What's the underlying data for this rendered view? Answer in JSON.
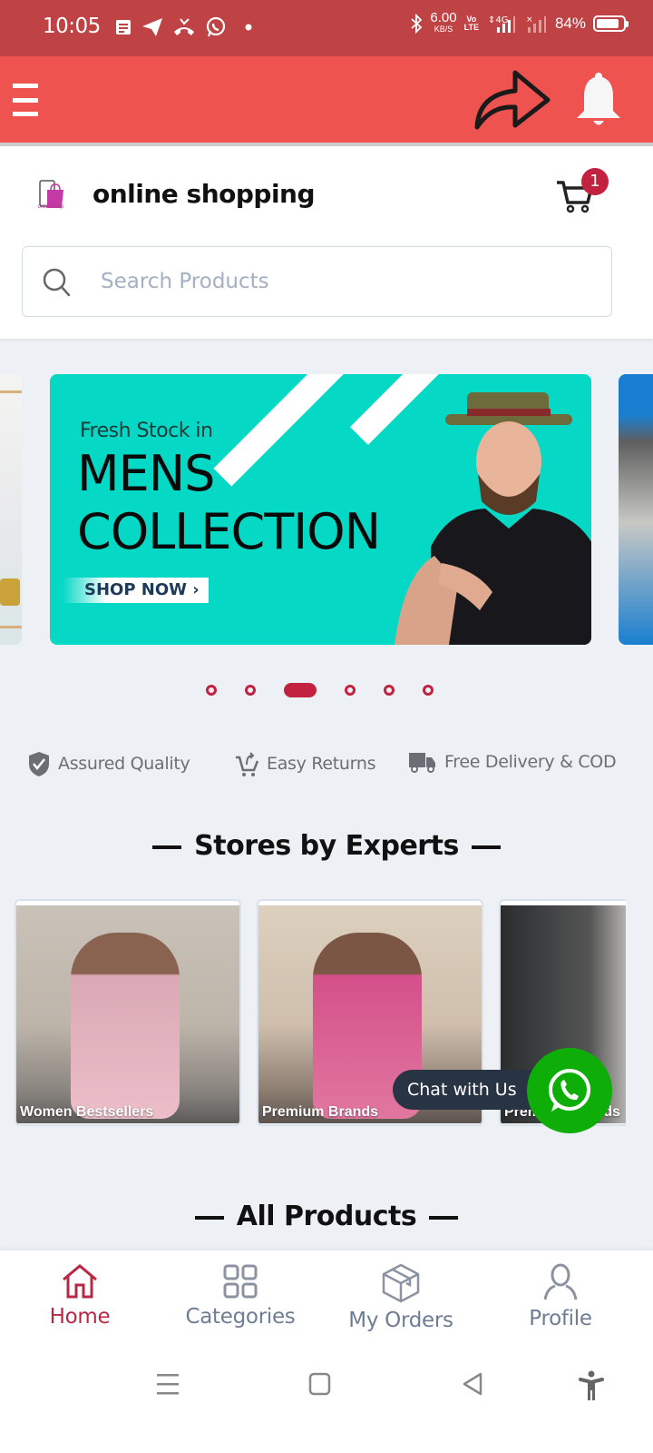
{
  "status_bar": {
    "time": "10:05",
    "left_icons": [
      "notes-icon",
      "telegram-icon",
      "missed-call-icon",
      "whatsapp-icon",
      "dot-icon"
    ],
    "net_speed_value": "6.00",
    "net_speed_unit": "KB/S",
    "volte_top": "Vo",
    "volte_bottom": "LTE",
    "network": "4G",
    "battery_percent": "84%",
    "battery_level": 0.84
  },
  "app_bar": {
    "menu_icon": "hamburger-menu-icon",
    "share_icon": "share-arrow-icon",
    "notification_icon": "bell-icon"
  },
  "header": {
    "logo_text": "onlineshop",
    "brand_name": "online shopping",
    "cart_count": "1",
    "search_placeholder": "Search Products",
    "search_value": ""
  },
  "carousel": {
    "slides_count": 6,
    "active_index": 2,
    "current_banner": {
      "kicker": "Fresh Stock in",
      "title_line1": "MENS",
      "title_line2": "COLLECTION",
      "cta": "SHOP NOW",
      "cta_arrow": "›"
    }
  },
  "features": [
    {
      "icon": "shield-check-icon",
      "label": "Assured Quality"
    },
    {
      "icon": "cart-return-icon",
      "label": "Easy Returns"
    },
    {
      "icon": "delivery-truck-icon",
      "label": "Free Delivery & COD"
    }
  ],
  "stores_section": {
    "title": "Stores by Experts",
    "stores": [
      {
        "label": "Women Bestsellers"
      },
      {
        "label": "Premium Brands"
      },
      {
        "label": "Premium Brands"
      }
    ]
  },
  "chat": {
    "label": "Chat with Us",
    "icon": "whatsapp-icon"
  },
  "all_products_section": {
    "title": "All Products"
  },
  "bottom_nav": {
    "active": "Home",
    "items": [
      {
        "label": "Home",
        "icon": "home-icon"
      },
      {
        "label": "Categories",
        "icon": "grid-icon"
      },
      {
        "label": "My Orders",
        "icon": "box-icon"
      },
      {
        "label": "Profile",
        "icon": "user-icon"
      }
    ]
  },
  "system_nav": {
    "buttons": [
      "recents-icon",
      "home-square-icon",
      "back-icon",
      "accessibility-icon"
    ]
  },
  "colors": {
    "status_bar": "#bf4244",
    "app_bar": "#ef5350",
    "accent": "#c2213f",
    "whatsapp_green": "#0ead07",
    "page_bg": "#edf1f5",
    "banner_teal": "#06d8c6"
  }
}
